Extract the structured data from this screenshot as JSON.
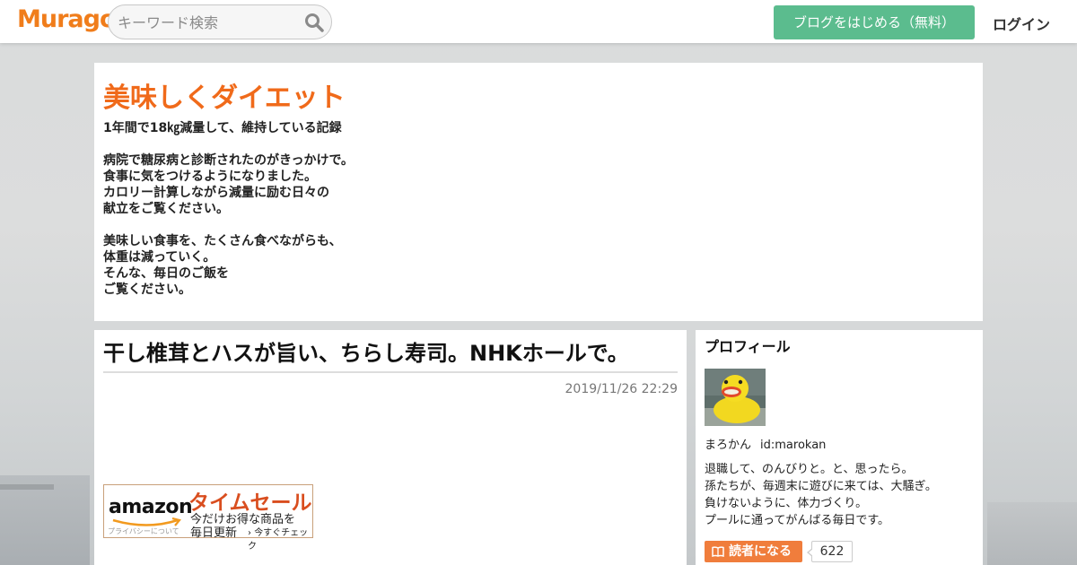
{
  "header": {
    "logo": "Muragon",
    "search_placeholder": "キーワード検索",
    "start_blog_label": "ブログをはじめる（無料）",
    "login_label": "ログイン"
  },
  "blog": {
    "title": "美味しくダイエット",
    "description": "1年間で18㎏減量して、維持している記録\n\n病院で糖尿病と診断されたのがきっかけで。\n食事に気をつけるようになりました。\nカロリー計算しながら減量に励む日々の\n献立をご覧ください。\n\n美味しい食事を、たくさん食べながらも、\n体重は減っていく。\nそんな、毎日のご飯を\nご覧ください。"
  },
  "article": {
    "title": "干し椎茸とハスが旨い、ちらし寿司。NHKホールで。",
    "date": "2019/11/26 22:29"
  },
  "amazon_banner": {
    "logo_text": "amazon",
    "privacy_text": "プライバシーについて",
    "sale_text": "タイムセール",
    "sub_line1": "今だけお得な商品を",
    "sub_line2": "毎日更新",
    "check_text": "今すぐチェック"
  },
  "profile": {
    "heading": "プロフィール",
    "name": "まろかん",
    "user_id": "id:marokan",
    "bio": "退職して、のんびりと。と、思ったら。\n孫たちが、毎週末に遊びに来ては、大騒ぎ。\n負けないように、体力づくり。\nプールに通ってがんばる毎日です。",
    "follow_label": "読者になる",
    "follower_count": "622"
  },
  "colors": {
    "brand_orange": "#f07d1b",
    "title_orange": "#f06a1a",
    "start_button_green": "#5bbc8e",
    "follow_button_orange": "#f07d3c"
  }
}
